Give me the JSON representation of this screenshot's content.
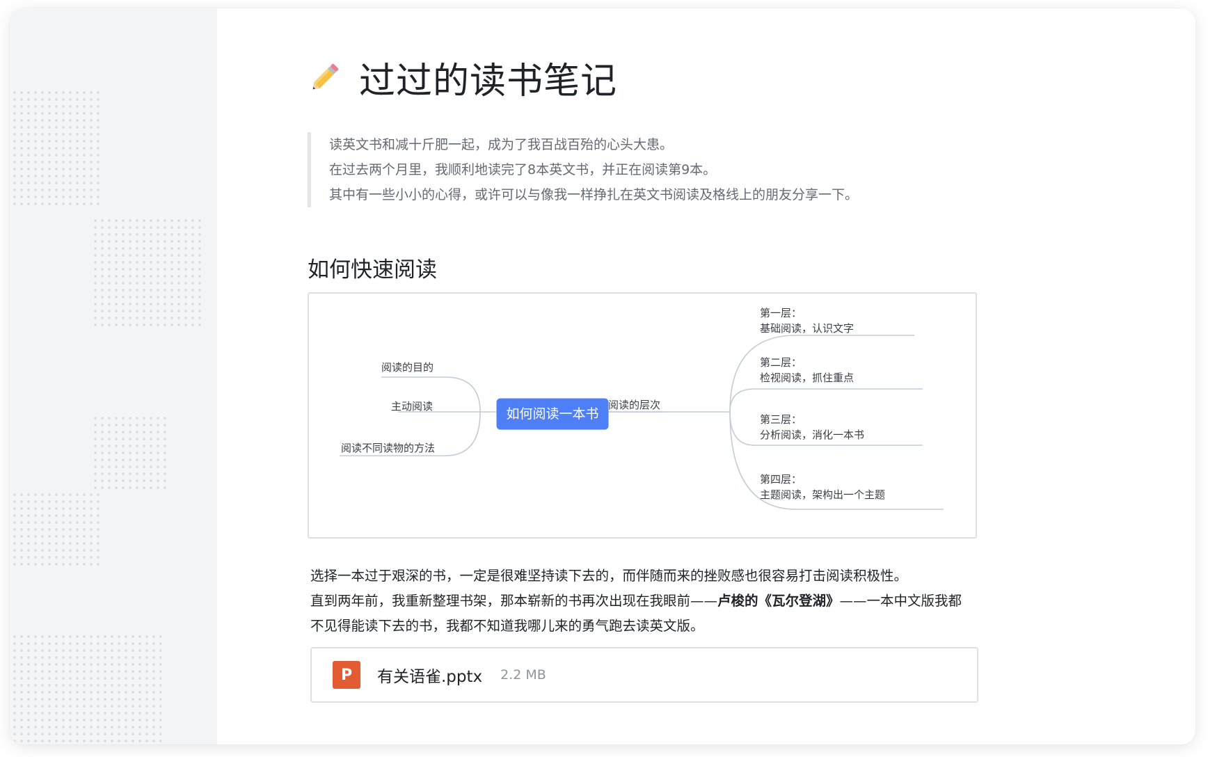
{
  "document": {
    "title": "过过的读书笔记",
    "title_icon": "pencil-icon",
    "quote": [
      "读英文书和减十斤肥一起，成为了我百战百殆的心头大患。",
      "在过去两个月里，我顺利地读完了8本英文书，并正在阅读第9本。",
      "其中有一些小小的心得，或许可以与像我一样挣扎在英文书阅读及格线上的朋友分享一下。"
    ],
    "heading": "如何快速阅读",
    "paragraph": {
      "line1": "选择一本过于艰深的书，一定是很难坚持读下去的，而伴随而来的挫败感也很容易打击阅读积极性。",
      "line2_a": "直到两年前，我重新整理书架，那本崭新的书再次出现在我眼前——",
      "line2_bold": "卢梭的《瓦尔登湖》",
      "line2_b": "——一本中文版我都",
      "line3": "不见得能读下去的书，我都不知道我哪儿来的勇气跑去读英文版。"
    },
    "attachment": {
      "icon_letter": "P",
      "icon_color": "#e25b33",
      "name": "有关语雀.pptx",
      "size": "2.2 MB"
    }
  },
  "mindmap": {
    "center": "如何阅读一本书",
    "center_color": "#4e7ff7",
    "left_nodes": [
      "阅读的目的",
      "主动阅读",
      "阅读不同读物的方法"
    ],
    "right_branch": "阅读的层次",
    "levels": [
      {
        "title": "第一层：",
        "desc": "基础阅读，认识文字"
      },
      {
        "title": "第二层：",
        "desc": "检视阅读，抓住重点"
      },
      {
        "title": "第三层：",
        "desc": "分析阅读，消化一本书"
      },
      {
        "title": "第四层：",
        "desc": "主题阅读，架构出一个主题"
      }
    ]
  },
  "outline": {
    "accent_color": "#2eb66f"
  }
}
